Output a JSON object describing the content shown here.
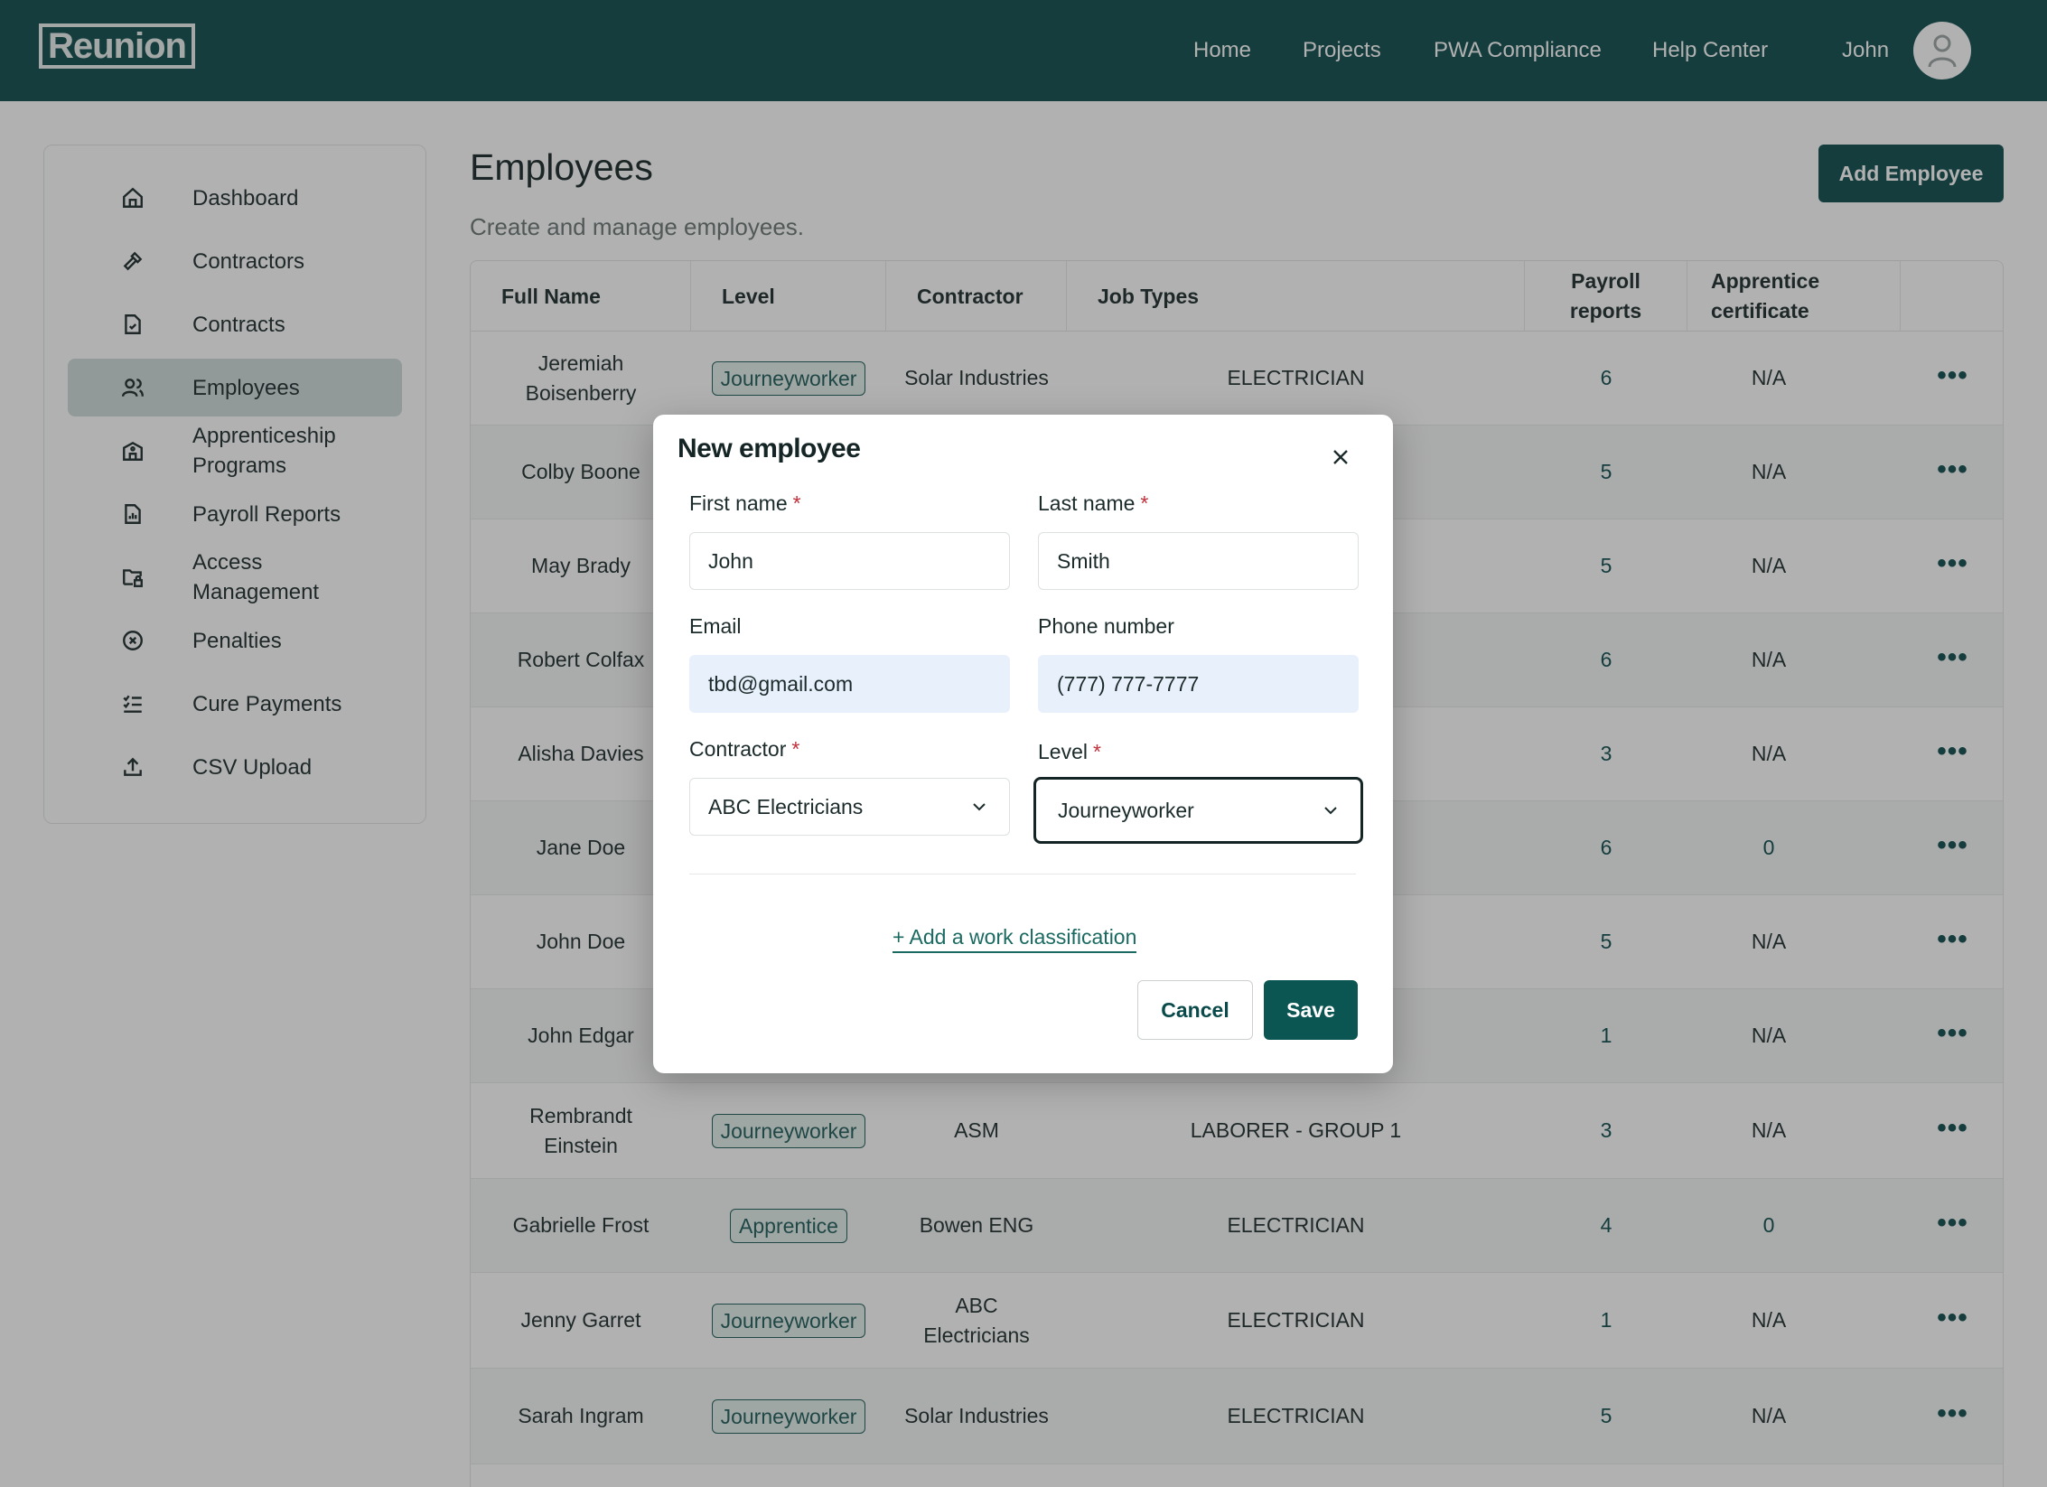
{
  "header": {
    "logo": "Reunion",
    "nav": [
      "Home",
      "Projects",
      "PWA Compliance",
      "Help Center"
    ],
    "user_name": "John"
  },
  "sidebar": {
    "items": [
      {
        "label": "Dashboard",
        "icon": "home-icon"
      },
      {
        "label": "Contractors",
        "icon": "hammer-icon"
      },
      {
        "label": "Contracts",
        "icon": "document-icon"
      },
      {
        "label": "Employees",
        "icon": "users-icon",
        "active": true
      },
      {
        "label": "Apprenticeship Programs",
        "icon": "building-icon"
      },
      {
        "label": "Payroll Reports",
        "icon": "report-icon"
      },
      {
        "label": "Access Management",
        "icon": "folder-lock-icon"
      },
      {
        "label": "Penalties",
        "icon": "x-circle-icon"
      },
      {
        "label": "Cure Payments",
        "icon": "checklist-icon"
      },
      {
        "label": "CSV Upload",
        "icon": "upload-icon"
      }
    ]
  },
  "main": {
    "title": "Employees",
    "subtitle": "Create and manage employees.",
    "add_button": "Add Employee"
  },
  "table": {
    "headers": [
      "Full Name",
      "Level",
      "Contractor",
      "Job Types",
      "Payroll reports",
      "Apprentice certificate"
    ],
    "rows": [
      {
        "name": "Jeremiah Boisenberry",
        "level": "Journeyworker",
        "contractor": "Solar Industries",
        "job": "ELECTRICIAN",
        "payroll": "6",
        "cert": "N/A"
      },
      {
        "name": "Colby Boone",
        "level": "",
        "contractor": "",
        "job": "",
        "payroll": "5",
        "cert": "N/A"
      },
      {
        "name": "May Brady",
        "level": "",
        "contractor": "",
        "job": "",
        "payroll": "5",
        "cert": "N/A"
      },
      {
        "name": "Robert Colfax",
        "level": "",
        "contractor": "",
        "job": "",
        "payroll": "6",
        "cert": "N/A"
      },
      {
        "name": "Alisha Davies",
        "level": "",
        "contractor": "",
        "job": "",
        "payroll": "3",
        "cert": "N/A"
      },
      {
        "name": "Jane Doe",
        "level": "",
        "contractor": "",
        "job": "",
        "payroll": "6",
        "cert": "0"
      },
      {
        "name": "John Doe",
        "level": "",
        "contractor": "",
        "job": "",
        "payroll": "5",
        "cert": "N/A"
      },
      {
        "name": "John Edgar",
        "level": "",
        "contractor": "",
        "job": "",
        "payroll": "1",
        "cert": "N/A"
      },
      {
        "name": "Rembrandt Einstein",
        "level": "Journeyworker",
        "contractor": "ASM",
        "job": "LABORER - GROUP 1",
        "payroll": "3",
        "cert": "N/A"
      },
      {
        "name": "Gabrielle Frost",
        "level": "Apprentice",
        "contractor": "Bowen ENG",
        "job": "ELECTRICIAN",
        "payroll": "4",
        "cert": "0"
      },
      {
        "name": "Jenny Garret",
        "level": "Journeyworker",
        "contractor": "ABC Electricians",
        "job": "ELECTRICIAN",
        "payroll": "1",
        "cert": "N/A"
      },
      {
        "name": "Sarah Ingram",
        "level": "Journeyworker",
        "contractor": "Solar Industries",
        "job": "ELECTRICIAN",
        "payroll": "5",
        "cert": "N/A"
      }
    ]
  },
  "modal": {
    "title": "New employee",
    "first_name_label": "First name",
    "first_name_value": "John",
    "last_name_label": "Last name",
    "last_name_value": "Smith",
    "email_label": "Email",
    "email_value": "tbd@gmail.com",
    "phone_label": "Phone number",
    "phone_value": "(777) 777-7777",
    "contractor_label": "Contractor",
    "contractor_value": "ABC Electricians",
    "level_label": "Level",
    "level_value": "Journeyworker",
    "required_mark": "*",
    "add_classification": "+ Add a work classification",
    "cancel": "Cancel",
    "save": "Save"
  },
  "colors": {
    "brand": "#0b4a4a",
    "required": "#c2303a",
    "autofill": "#e8f0fc"
  }
}
